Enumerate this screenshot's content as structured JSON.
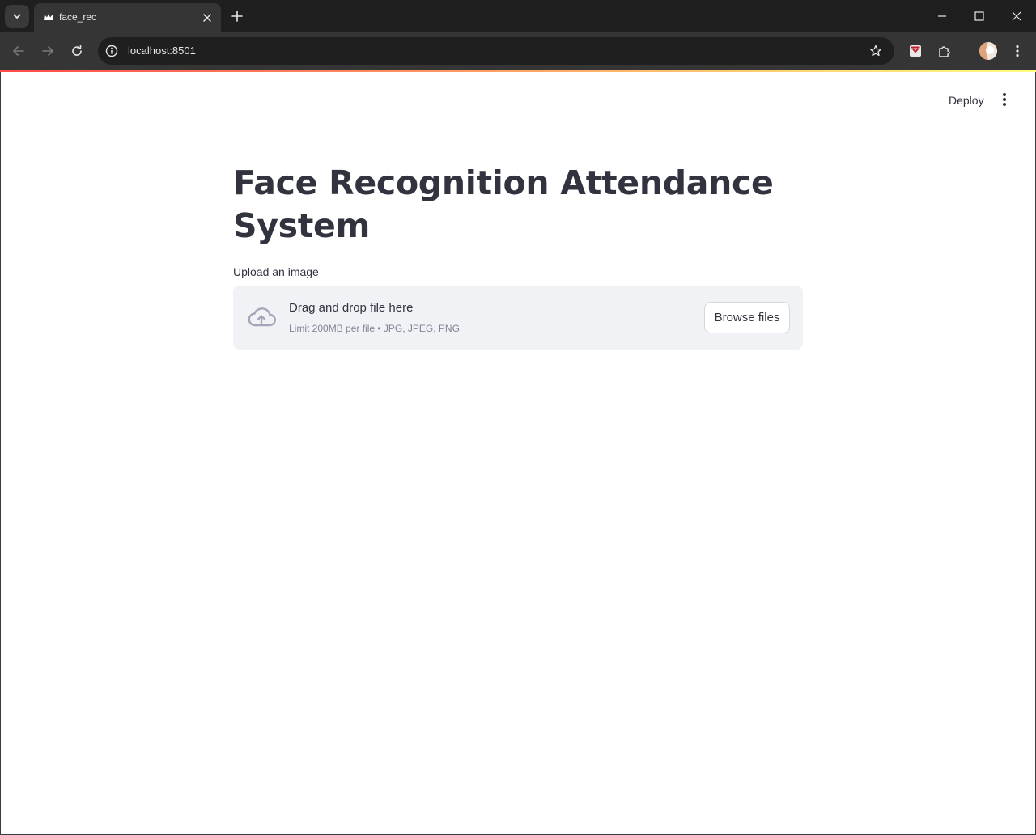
{
  "browser": {
    "tab_title": "face_rec",
    "url": "localhost:8501"
  },
  "colors": {
    "accent": "#ff4b4b",
    "decoration_end": "#fffd80",
    "text": "#31333f",
    "dropzone_bg": "#f0f2f6"
  },
  "icons": [
    "tab-search-icon",
    "streamlit-crown-icon",
    "close-icon",
    "plus-icon",
    "minimize-icon",
    "maximize-icon",
    "back-icon",
    "forward-icon",
    "reload-icon",
    "site-info-icon",
    "bookmark-star-icon",
    "extension-icon",
    "puzzle-icon",
    "profile-avatar",
    "browser-menu-icon",
    "more-vert-icon",
    "cloud-upload-icon"
  ],
  "header": {
    "deploy_label": "Deploy"
  },
  "main": {
    "title": "Face Recognition Attendance System",
    "uploader": {
      "label": "Upload an image",
      "drop_text": "Drag and drop file here",
      "limit_text": "Limit 200MB per file • JPG, JPEG, PNG",
      "browse_label": "Browse files"
    }
  }
}
